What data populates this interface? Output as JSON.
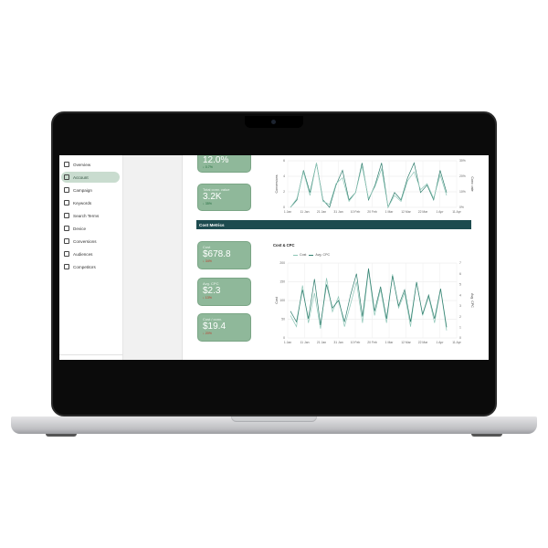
{
  "sidebar": {
    "items": [
      {
        "label": "Overview",
        "icon": "home-icon",
        "active": false
      },
      {
        "label": "Account",
        "icon": "user-icon",
        "active": true
      },
      {
        "label": "Campaign",
        "icon": "megaphone-icon",
        "active": false
      },
      {
        "label": "Keywords",
        "icon": "key-icon",
        "active": false
      },
      {
        "label": "Search Terms",
        "icon": "search-icon",
        "active": false
      },
      {
        "label": "Device",
        "icon": "device-icon",
        "active": false
      },
      {
        "label": "Conversions",
        "icon": "cart-icon",
        "active": false
      },
      {
        "label": "Audiences",
        "icon": "globe-icon",
        "active": false
      },
      {
        "label": "Competitors",
        "icon": "eye-icon",
        "active": false
      }
    ]
  },
  "top_cards": [
    {
      "label": "",
      "value": "12.0%",
      "delta": "↓ 0.7%"
    },
    {
      "label": "Total conv. value",
      "value": "3.2K",
      "delta": "↓ 35%"
    }
  ],
  "cost_section": {
    "title": "Cost Metrics",
    "cards": [
      {
        "label": "Cost",
        "value": "$678.8",
        "delta": "↓ 34%"
      },
      {
        "label": "Avg. CPC",
        "value": "$2.3",
        "delta": "↓ 13%"
      },
      {
        "label": "Cost / conv.",
        "value": "$19.4",
        "delta": "↓ 20%"
      }
    ]
  },
  "colors": {
    "accent": "#1d4b4f",
    "card": "#8fb89a",
    "active_nav": "#c9dccf",
    "series_dark": "#2f7d6d",
    "series_light": "#8ec6b7"
  },
  "chart_data": [
    {
      "type": "line",
      "title": "",
      "xlabel": "",
      "ylabel": "Conversions",
      "y2label": "Conv. rate",
      "x": [
        "1 Jan",
        "11 Jan",
        "21 Jan",
        "31 Jan",
        "10 Feb",
        "20 Feb",
        "1 Mar",
        "12 Mar",
        "22 Mar",
        "1 Apr",
        "11 Apr"
      ],
      "yticks": [
        "0",
        "2",
        "4",
        "6"
      ],
      "y2ticks": [
        "0%",
        "10%",
        "20%",
        "30%"
      ],
      "series": [
        {
          "name": "Conversions",
          "values": [
            0,
            1,
            5,
            2,
            6,
            1,
            0,
            3,
            5,
            1,
            2,
            6,
            1,
            3,
            6,
            0,
            2,
            1,
            4,
            6,
            2,
            3,
            1,
            5,
            2
          ]
        },
        {
          "name": "Conv. rate",
          "values": [
            0,
            3,
            12,
            4,
            15,
            2,
            1,
            8,
            10,
            2,
            5,
            14,
            3,
            7,
            13,
            0,
            4,
            2,
            9,
            12,
            6,
            8,
            3,
            11,
            4
          ]
        }
      ]
    },
    {
      "type": "line",
      "title": "Cost & CPC",
      "xlabel": "",
      "ylabel": "Cost",
      "y2label": "Avg. CPC",
      "x": [
        "1 Jan",
        "11 Jan",
        "21 Jan",
        "31 Jan",
        "10 Feb",
        "20 Feb",
        "1 Mar",
        "12 Mar",
        "22 Mar",
        "1 Apr",
        "11 Apr"
      ],
      "ylim": [
        0,
        200
      ],
      "y2lim": [
        0,
        7
      ],
      "yticks": [
        "0",
        "50",
        "100",
        "150",
        "200"
      ],
      "y2ticks": [
        "0",
        "1",
        "2",
        "3",
        "4",
        "5",
        "6",
        "7"
      ],
      "series": [
        {
          "name": "Cost",
          "axis": "left",
          "values": [
            60,
            30,
            140,
            40,
            120,
            25,
            160,
            70,
            110,
            30,
            90,
            150,
            40,
            180,
            60,
            130,
            40,
            170,
            80,
            120,
            30,
            150,
            60,
            110,
            40,
            130,
            20
          ]
        },
        {
          "name": "Avg. CPC",
          "axis": "right",
          "values": [
            2.5,
            1.5,
            4.5,
            1.8,
            5.5,
            1.2,
            5.0,
            2.8,
            3.5,
            1.5,
            4.0,
            6.0,
            2.0,
            6.5,
            2.5,
            4.8,
            1.8,
            5.8,
            3.0,
            4.5,
            1.5,
            5.2,
            2.2,
            4.0,
            1.8,
            4.6,
            1.0
          ]
        }
      ]
    }
  ]
}
